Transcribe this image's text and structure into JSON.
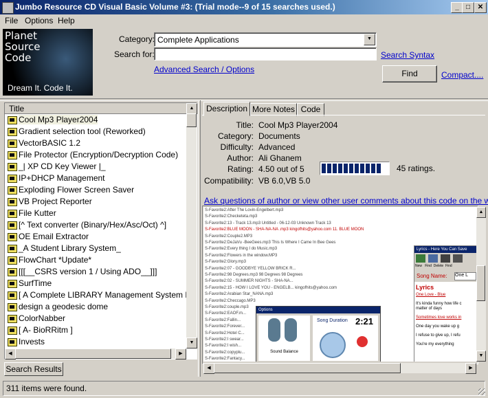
{
  "window": {
    "title": "Jumbo Resource CD Visual Basic Volume #3: (Trial mode--9 of 15 searches used.)",
    "buttons": {
      "minimize": "_",
      "maximize": "□",
      "close": "✕"
    }
  },
  "menu": {
    "items": [
      "File",
      "Options",
      "Help"
    ]
  },
  "logo": {
    "line1": "Planet",
    "line2": "Source",
    "line3": "Code",
    "tagline": "Dream It.  Code It."
  },
  "search": {
    "category_label": "Category:",
    "category_value": "Complete Applications",
    "search_label": "Search for:",
    "search_value": "",
    "syntax_link": "Search Syntax",
    "advanced_link": "Advanced Search / Options",
    "find_label": "Find",
    "compact_link": "Compact...."
  },
  "list": {
    "header": "Title",
    "items": [
      "Cool Mp3 Player2004",
      "Gradient selection tool (Reworked)",
      "VectorBASIC 1.2",
      "File Protector (Encryption/Decryption Code)",
      "_| XP CD Key Viewer |_",
      "IP+DHCP Management",
      "Exploding Flower Screen Saver",
      "VB Project Reporter",
      "File Kutter",
      "[^ Text converter (Binary/Hex/Asc/Oct) ^]",
      "OE Email Extractor",
      "_A Student Library System_",
      "FlowChart *Update*",
      "[[[__CSRS version 1 / Using ADO__]]]",
      "SurfTime",
      "[ A Complete LIBRARY  Management System  NEW",
      "design a geodesic dome",
      "ColorNabber",
      "[    A- BioRRitm    ]",
      "Invests"
    ],
    "tab_label": "Search Results"
  },
  "detail": {
    "tabs": [
      "Description",
      "More Notes",
      "Code"
    ],
    "labels": {
      "title": "Title:",
      "category": "Category:",
      "difficulty": "Difficulty:",
      "author": "Author:",
      "rating": "Rating:",
      "compat": "Compatibility:"
    },
    "title": "Cool Mp3 Player2004",
    "category": "Documents",
    "difficulty": "Advanced",
    "author": "Ali Ghanem",
    "rating": "4.50 out of 5",
    "rating_fraction": 0.9,
    "ratings_count": "45 ratings.",
    "compat": "VB 6.0,VB 5.0",
    "ask_link": "Ask questions of author or view other user comments about this code on the web...."
  },
  "screenshot": {
    "rows": [
      "S-Favorite2:After The Lovin-Engelbert.mp3",
      "S-Favorite2:Checketeta.mp3",
      "S-Favorite2:13 - Track 13.mp3           Untitled - 06-12-03        Unknown           Track 13",
      "S-Favorite2:BLUE MOON - SHA-NA-NA .mp3   kingofhits@yahoo.com                 11. BLUE MOON",
      "S-Favorite2:Couple2.MP3",
      "S-Favorite2:DeJaVu -BeeGees.mp3          This Is Where I Came In     Bee Gees",
      "S-Favorite2:Every thing I do Music.mp3",
      "S-Favorite2:Flowers in the window.MP3",
      "S-Favorite2:Glory.mp3",
      "S-Favorite2:07 - GOODBYE YELLOW BRICK R...",
      "S-Favorite2:98 Degrees.mp3            98 Degrees             98 Degrees",
      "S-Favorite2:02 - SUMMER NIGHTS - SHA-NA...",
      "S-Favorite2:15 - HOW I LOVE YOU - ENGELB...   kingofhits@yahoo.com",
      "S-Favorite2:Arabian Star_NANA.mp3",
      "S-Favorite2:Checcago.MP3"
    ],
    "rows2": [
      "S-Favorite2:couple.mp3",
      "S-Favorite2:EAOF.m...",
      "S-Favorite2:Fallin...",
      "S-Favorite2:Forever...",
      "S-Favorite2:Hotel C...",
      "S-Favorite2:I swear...",
      "S-Favorite2:I wish...",
      "S-Favorite2:copyplu...",
      "S-Favorite2:Fantacy...",
      "S-Favorite2:I wanna..."
    ],
    "toolbar_items": [
      "New",
      "Find",
      "Delete",
      "Find"
    ],
    "song_name_label": "Song Name:",
    "song_name_value": "One L",
    "lyrics_heading": "Lyrics",
    "lyrics_window_title": "Lyrics - Here You Can Save",
    "lyrics": [
      "One Love - Blue",
      "It's kinda funny how life c",
      "matter of days",
      "Sometimes love works in",
      "One day you wake up g",
      "I refuse to give up, I refu",
      "You're my everything"
    ],
    "options_title": "Options",
    "sound_balance": "Sound Balance",
    "song_duration": "Song Duration",
    "duration": "2:21"
  },
  "status": {
    "text": "311 items were found."
  },
  "colors": {
    "title_start": "#0a246a",
    "title_end": "#a6caf0",
    "link": "#0000cc",
    "rating_fill": "#0a246a"
  }
}
